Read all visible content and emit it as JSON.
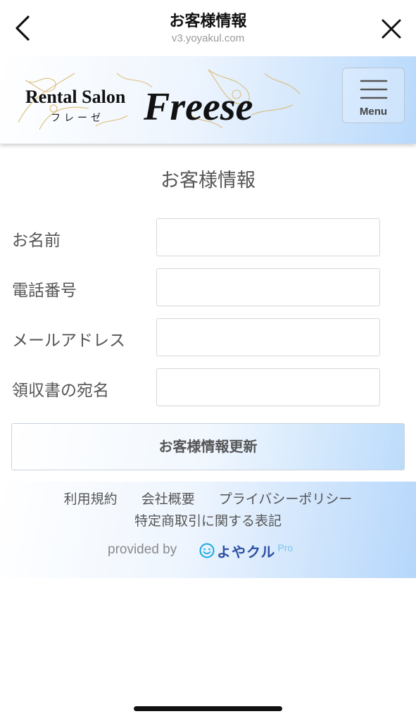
{
  "browser": {
    "title": "お客様情報",
    "url": "v3.yoyakul.com"
  },
  "header": {
    "logo_line1": "Rental Salon",
    "logo_kana": "フレーゼ",
    "logo_script": "Freese",
    "menu_label": "Menu"
  },
  "page": {
    "heading": "お客様情報"
  },
  "form": {
    "fields": [
      {
        "label": "お名前",
        "value": ""
      },
      {
        "label": "電話番号",
        "value": ""
      },
      {
        "label": "メールアドレス",
        "value": ""
      },
      {
        "label": "領収書の宛名",
        "value": ""
      }
    ],
    "submit_label": "お客様情報更新"
  },
  "footer": {
    "links": [
      "利用規約",
      "会社概要",
      "プライバシーポリシー"
    ],
    "link_tokushoho": "特定商取引に関する表記",
    "provided_by": "provided by",
    "brand_name": "よやクル",
    "brand_suffix": "Pro"
  },
  "colors": {
    "accent_gradient_end": "#b9d9fb",
    "brand_blue": "#2d4fa3"
  }
}
